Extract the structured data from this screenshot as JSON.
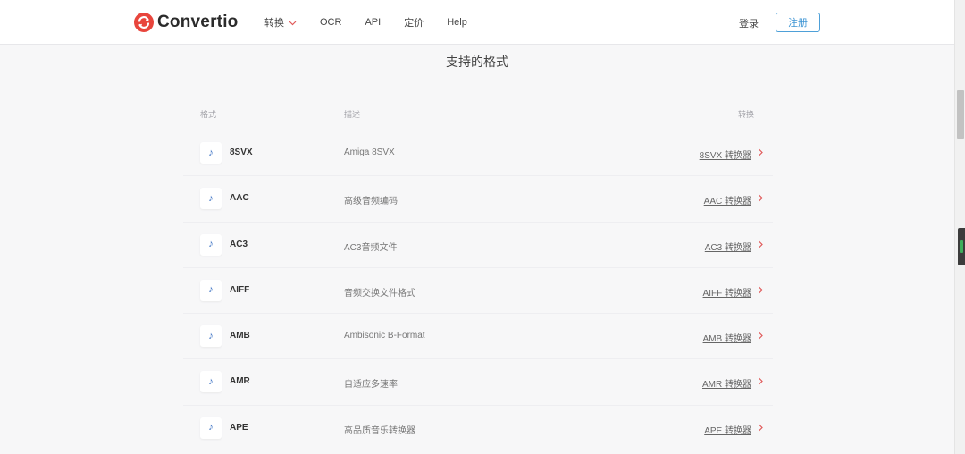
{
  "header": {
    "logo_text": "Convertio",
    "nav": [
      {
        "label": "转换",
        "has_dropdown": true
      },
      {
        "label": "OCR"
      },
      {
        "label": "API"
      },
      {
        "label": "定价"
      },
      {
        "label": "Help"
      }
    ],
    "login_label": "登录",
    "register_label": "注册"
  },
  "page": {
    "title": "支持的格式"
  },
  "table": {
    "headers": {
      "format": "格式",
      "description": "描述",
      "convert": "转换"
    },
    "rows": [
      {
        "format": "8SVX",
        "description": "Amiga 8SVX",
        "convert": "8SVX 转换器"
      },
      {
        "format": "AAC",
        "description": "高级音频编码",
        "convert": "AAC 转换器"
      },
      {
        "format": "AC3",
        "description": "AC3音频文件",
        "convert": "AC3 转换器"
      },
      {
        "format": "AIFF",
        "description": "音频交换文件格式",
        "convert": "AIFF 转换器"
      },
      {
        "format": "AMB",
        "description": "Ambisonic B-Format",
        "convert": "AMB 转换器"
      },
      {
        "format": "AMR",
        "description": "自适应多速率",
        "convert": "AMR 转换器"
      },
      {
        "format": "APE",
        "description": "高品质音乐转换器",
        "convert": "APE 转换器"
      }
    ]
  },
  "icons": {
    "row_icon": "music-note-icon",
    "row_arrow": "chevron-right-icon",
    "nav_dropdown": "chevron-down-icon"
  },
  "colors": {
    "brand_red": "#e8453c",
    "accent_blue": "#3e95d4",
    "note_blue": "#3f74c4",
    "arrow_red": "#e05a5a"
  }
}
